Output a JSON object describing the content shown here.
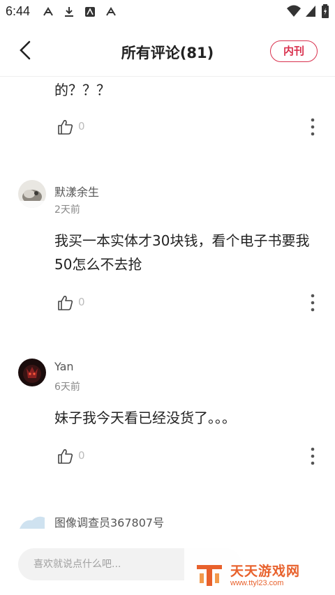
{
  "status_bar": {
    "time": "6:44"
  },
  "header": {
    "title": "所有评论(81)",
    "tag_label": "内刊"
  },
  "comments": [
    {
      "content": "的？？？",
      "likes": "0"
    },
    {
      "username": "默漾余生",
      "time": "2天前",
      "content": "我买一本实体才30块钱，看个电子书要我50怎么不去抢",
      "likes": "0"
    },
    {
      "username": "Yan",
      "time": "6天前",
      "content": "妹子我今天看已经没货了。。。",
      "likes": "0"
    },
    {
      "username": "图像调查员367807号"
    }
  ],
  "input": {
    "placeholder": "喜欢就说点什么吧..."
  },
  "watermark": {
    "title": "天天游戏网",
    "url": "www.ttyl23.com"
  },
  "colors": {
    "accent": "#d9304d",
    "watermark": "#e8612c"
  }
}
